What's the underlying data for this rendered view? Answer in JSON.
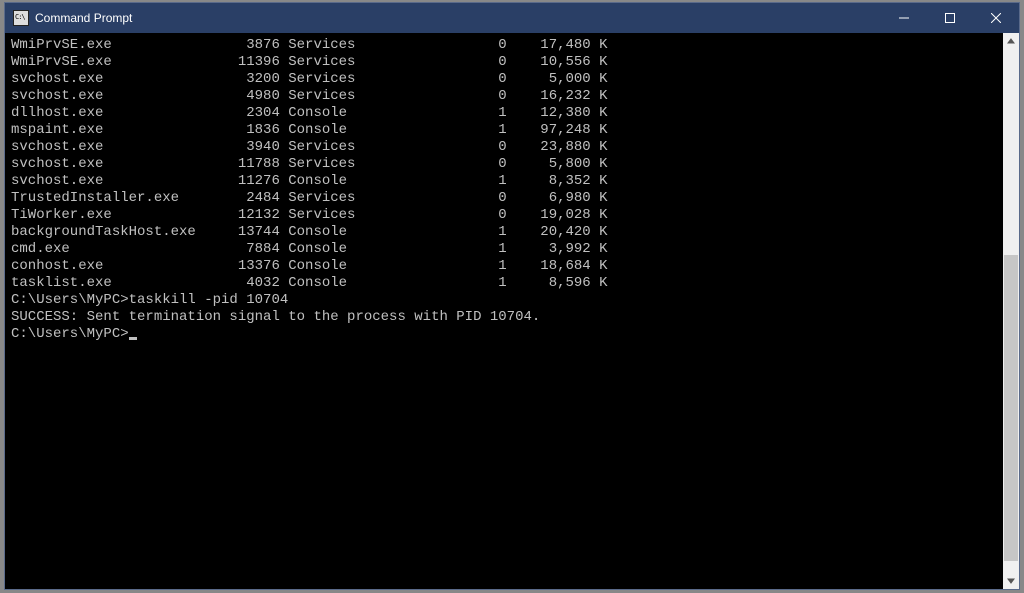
{
  "window": {
    "title": "Command Prompt"
  },
  "columns": {
    "name_w": 25,
    "pid_w": 7,
    "session_w": 16,
    "sess_no_w": 10,
    "mem_w": 12
  },
  "processes": [
    {
      "name": "WmiPrvSE.exe",
      "pid": 3876,
      "session": "Services",
      "sess_no": 0,
      "mem": "17,480 K"
    },
    {
      "name": "WmiPrvSE.exe",
      "pid": 11396,
      "session": "Services",
      "sess_no": 0,
      "mem": "10,556 K"
    },
    {
      "name": "svchost.exe",
      "pid": 3200,
      "session": "Services",
      "sess_no": 0,
      "mem": "5,000 K"
    },
    {
      "name": "svchost.exe",
      "pid": 4980,
      "session": "Services",
      "sess_no": 0,
      "mem": "16,232 K"
    },
    {
      "name": "dllhost.exe",
      "pid": 2304,
      "session": "Console",
      "sess_no": 1,
      "mem": "12,380 K"
    },
    {
      "name": "mspaint.exe",
      "pid": 1836,
      "session": "Console",
      "sess_no": 1,
      "mem": "97,248 K"
    },
    {
      "name": "svchost.exe",
      "pid": 3940,
      "session": "Services",
      "sess_no": 0,
      "mem": "23,880 K"
    },
    {
      "name": "svchost.exe",
      "pid": 11788,
      "session": "Services",
      "sess_no": 0,
      "mem": "5,800 K"
    },
    {
      "name": "svchost.exe",
      "pid": 11276,
      "session": "Console",
      "sess_no": 1,
      "mem": "8,352 K"
    },
    {
      "name": "TrustedInstaller.exe",
      "pid": 2484,
      "session": "Services",
      "sess_no": 0,
      "mem": "6,980 K"
    },
    {
      "name": "TiWorker.exe",
      "pid": 12132,
      "session": "Services",
      "sess_no": 0,
      "mem": "19,028 K"
    },
    {
      "name": "backgroundTaskHost.exe",
      "pid": 13744,
      "session": "Console",
      "sess_no": 1,
      "mem": "20,420 K"
    },
    {
      "name": "cmd.exe",
      "pid": 7884,
      "session": "Console",
      "sess_no": 1,
      "mem": "3,992 K"
    },
    {
      "name": "conhost.exe",
      "pid": 13376,
      "session": "Console",
      "sess_no": 1,
      "mem": "18,684 K"
    },
    {
      "name": "tasklist.exe",
      "pid": 4032,
      "session": "Console",
      "sess_no": 1,
      "mem": "8,596 K"
    }
  ],
  "prompt_path": "C:\\Users\\MyPC>",
  "command": "taskkill -pid 10704",
  "result": "SUCCESS: Sent termination signal to the process with PID 10704.",
  "scrollbar": {
    "thumb_top_pct": 40,
    "thumb_height_pct": 55
  }
}
